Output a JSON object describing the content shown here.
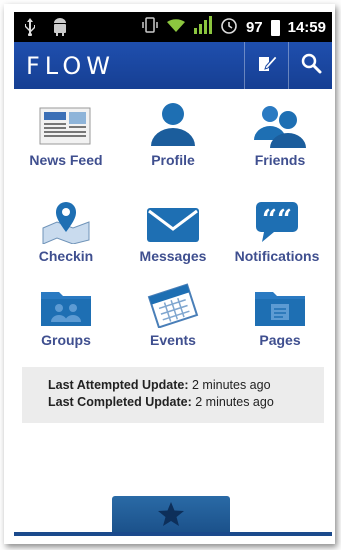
{
  "statusbar": {
    "icons": [
      "usb-icon",
      "android-icon",
      "vibrate-icon",
      "wifi-icon",
      "signal-icon",
      "alarm-icon"
    ],
    "battery": "97",
    "time": "14:59"
  },
  "appbar": {
    "title": "FLOW",
    "compose_icon": "compose-icon",
    "search_icon": "search-icon"
  },
  "menu": [
    {
      "label": "News Feed",
      "icon": "newspaper-icon"
    },
    {
      "label": "Profile",
      "icon": "person-icon"
    },
    {
      "label": "Friends",
      "icon": "people-icon"
    },
    {
      "label": "Checkin",
      "icon": "map-pin-icon"
    },
    {
      "label": "Messages",
      "icon": "envelope-icon"
    },
    {
      "label": "Notifications",
      "icon": "quote-bubble-icon"
    },
    {
      "label": "Groups",
      "icon": "group-folder-icon"
    },
    {
      "label": "Events",
      "icon": "calendar-icon"
    },
    {
      "label": "Pages",
      "icon": "pages-folder-icon"
    }
  ],
  "update": {
    "attempted_label": "Last Attempted Update:",
    "attempted_value": "2 minutes ago",
    "completed_label": "Last Completed Update:",
    "completed_value": "2 minutes ago"
  },
  "bottom": {
    "tab_icon": "star-icon"
  },
  "colors": {
    "appbar": "#1b49a3",
    "label": "#3f4f8f",
    "icon_blue": "#1e6fb3"
  }
}
